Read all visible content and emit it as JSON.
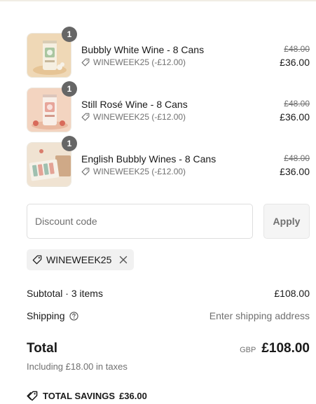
{
  "items": [
    {
      "quantity": "1",
      "name": "Bubbly White Wine - 8 Cans",
      "discount_code": "WINEWEEK25 (-£12.00)",
      "original_price": "£48.00",
      "price": "£36.00"
    },
    {
      "quantity": "1",
      "name": "Still Rosé Wine - 8 Cans",
      "discount_code": "WINEWEEK25 (-£12.00)",
      "original_price": "£48.00",
      "price": "£36.00"
    },
    {
      "quantity": "1",
      "name": "English Bubbly Wines - 8 Cans",
      "discount_code": "WINEWEEK25 (-£12.00)",
      "original_price": "£48.00",
      "price": "£36.00"
    }
  ],
  "discount": {
    "placeholder": "Discount code",
    "value": "",
    "apply_label": "Apply",
    "applied_code": "WINEWEEK25"
  },
  "summary": {
    "subtotal_label": "Subtotal · 3 items",
    "subtotal_value": "£108.00",
    "shipping_label": "Shipping",
    "shipping_value": "Enter shipping address",
    "total_label": "Total",
    "currency": "GBP",
    "total_value": "£108.00",
    "taxes_note": "Including £18.00 in taxes",
    "savings_label": "TOTAL SAVINGS",
    "savings_value": "£36.00"
  },
  "icons": {
    "tag": "tag-icon",
    "help": "help-circle-icon",
    "remove": "close-icon",
    "savings": "savings-tag-icon"
  },
  "colors": {
    "muted_text": "#707070",
    "quantity_badge": "#666666",
    "tag_background": "#f1f1f1"
  }
}
